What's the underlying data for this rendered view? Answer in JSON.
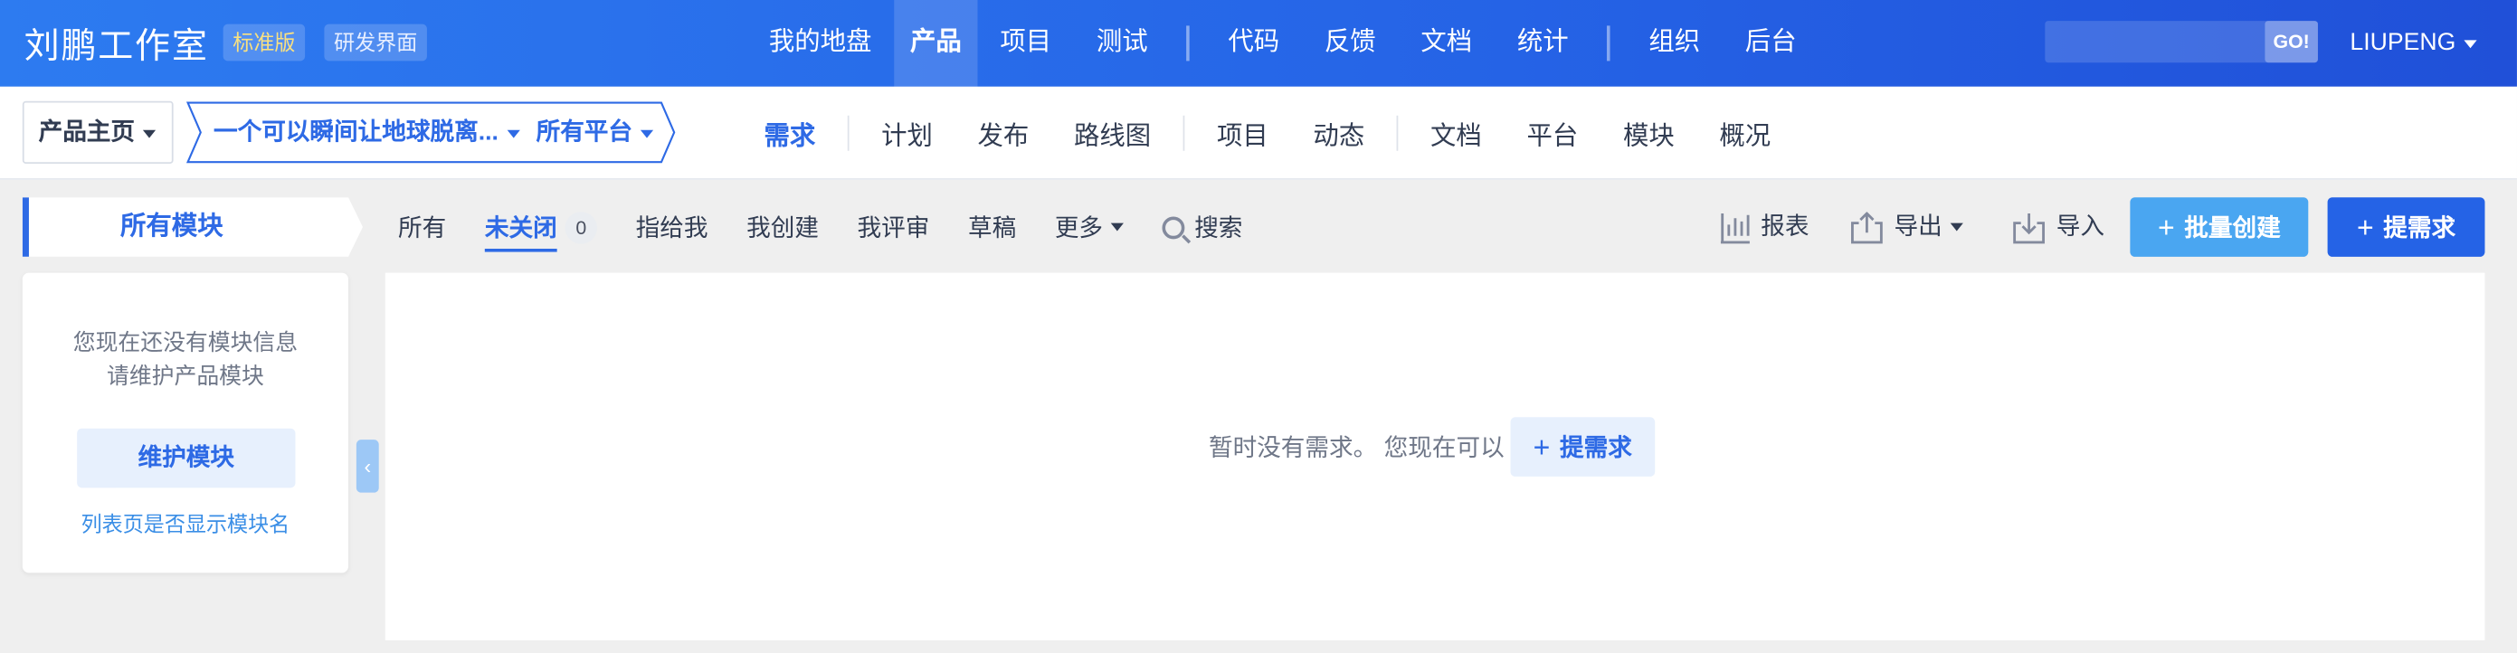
{
  "header": {
    "brand": "刘鹏工作室",
    "edition_tag": "标准版",
    "view_tag": "研发界面",
    "nav": [
      "我的地盘",
      "产品",
      "项目",
      "测试",
      "代码",
      "反馈",
      "文档",
      "统计",
      "组织",
      "后台"
    ],
    "active_nav": "产品",
    "search_placeholder": "",
    "go_label": "GO!",
    "user": "LIUPENG"
  },
  "subheader": {
    "home": "产品主页",
    "product_name": "一个可以瞬间让地球脱离...",
    "platform": "所有平台",
    "nav": [
      "需求",
      "计划",
      "发布",
      "路线图",
      "项目",
      "动态",
      "文档",
      "平台",
      "模块",
      "概况"
    ],
    "active_nav": "需求"
  },
  "modules": {
    "title": "所有模块",
    "empty_line1": "您现在还没有模块信息",
    "empty_line2": "请维护产品模块",
    "maintain_button": "维护模块",
    "toggle_link": "列表页是否显示模块名"
  },
  "features": {
    "tabs": [
      "所有",
      "未关闭",
      "指给我",
      "我创建",
      "我评审",
      "草稿",
      "更多"
    ],
    "active_tab": "未关闭",
    "unclosed_count": "0",
    "search": "搜索"
  },
  "toolbar": {
    "report": "报表",
    "export": "导出",
    "import": "导入",
    "batch_create": "批量创建",
    "add_story": "提需求"
  },
  "main": {
    "empty_text": "暂时没有需求。 您现在可以",
    "empty_button": "提需求"
  },
  "colors": {
    "primary": "#2563e6",
    "accent_light": "#e7f0fd",
    "batch_button": "#4aa6f1",
    "edition_tag_text": "#f8e081"
  }
}
